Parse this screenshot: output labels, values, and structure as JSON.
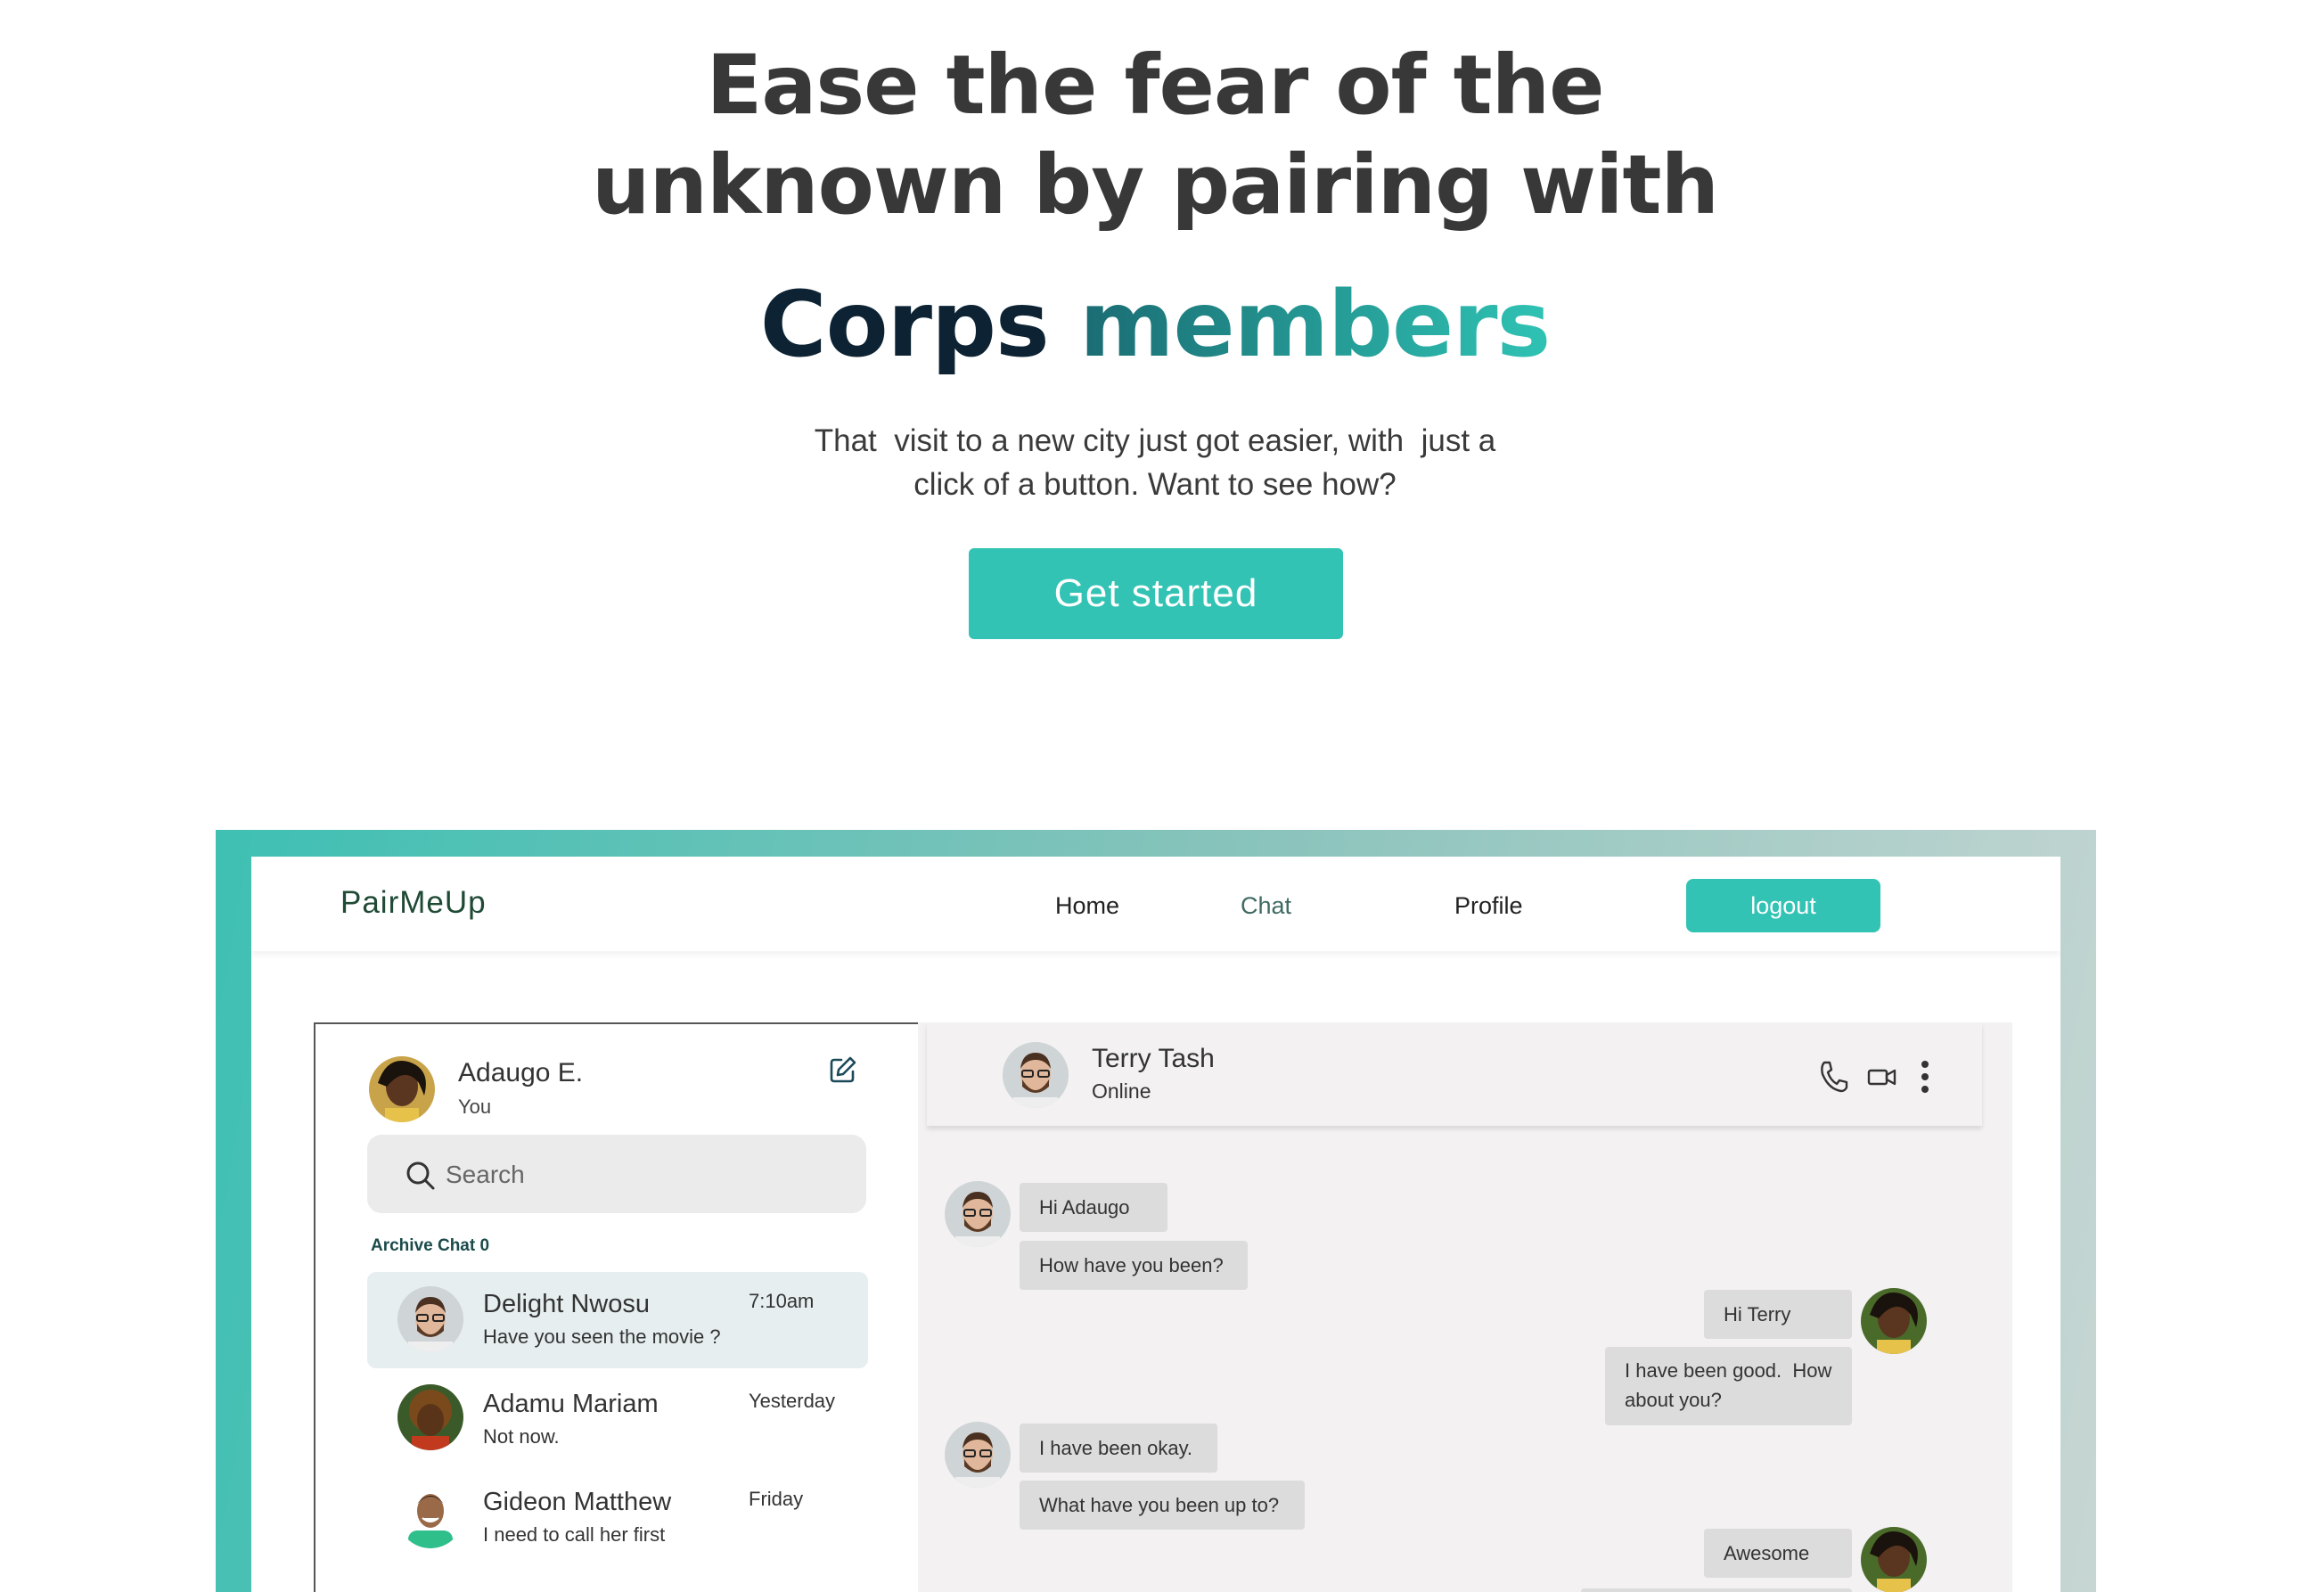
{
  "hero": {
    "title_line1": "Ease the fear of the",
    "title_line2": "unknown by pairing with",
    "accent_word1": "Corps",
    "accent_word2": "members",
    "subtitle_line1": "That  visit to a new city just got easier, with  just a",
    "subtitle_line2": "click of a button. Want to see how?",
    "cta_label": "Get started"
  },
  "app": {
    "brand": "PairMeUp",
    "nav": {
      "home": "Home",
      "chat": "Chat",
      "profile": "Profile",
      "logout": "logout"
    },
    "me": {
      "name": "Adaugo E.",
      "subtitle": "You"
    },
    "search": {
      "placeholder": "Search"
    },
    "archive_label": "Archive Chat 0",
    "chats": [
      {
        "name": "Delight Nwosu",
        "message": "Have you seen the movie ?",
        "time": "7:10am"
      },
      {
        "name": "Adamu Mariam",
        "message": "Not now.",
        "time": "Yesterday"
      },
      {
        "name": "Gideon Matthew",
        "message": "I need to call her first",
        "time": "Friday"
      }
    ],
    "conversation": {
      "peer_name": "Terry Tash",
      "peer_status": "Online",
      "icons": [
        "phone-icon",
        "video-icon",
        "more-vertical-icon"
      ],
      "messages": [
        {
          "from": "peer",
          "text": "Hi Adaugo"
        },
        {
          "from": "peer",
          "text": "How have you been?"
        },
        {
          "from": "me",
          "text": "Hi Terry"
        },
        {
          "from": "me",
          "text_line1": "I have been good.  How",
          "text_line2": "about you?"
        },
        {
          "from": "peer",
          "text": "I have been okay."
        },
        {
          "from": "peer",
          "text": "What have you been up to?"
        },
        {
          "from": "me",
          "text": "Awesome"
        }
      ]
    }
  },
  "colors": {
    "accent": "#32c3b4",
    "title": "#383838",
    "accent_dark": "#0d2333",
    "bubble": "#dcdcdc",
    "chat_bg": "#f3f1f1"
  }
}
